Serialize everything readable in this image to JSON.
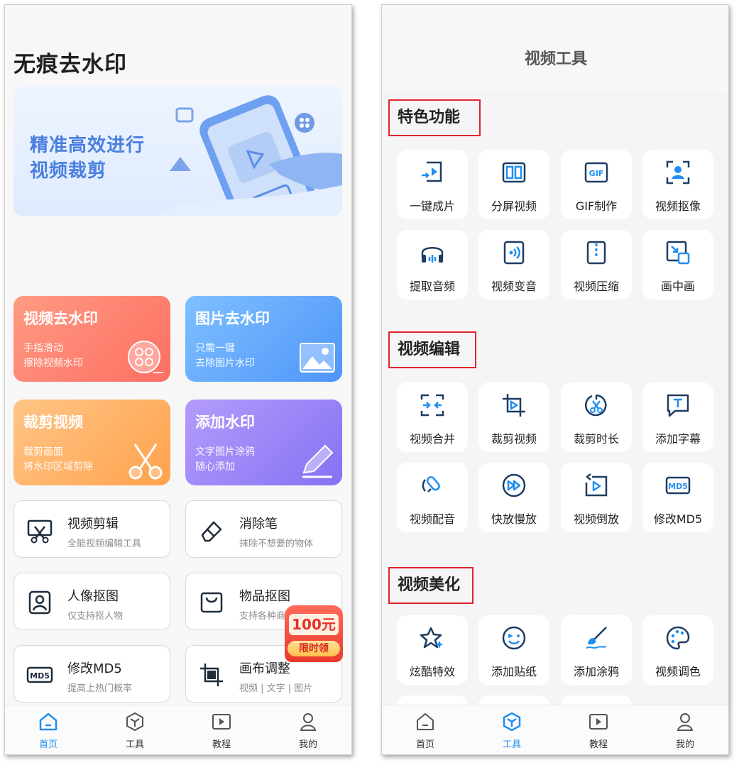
{
  "home": {
    "app_title": "无痕去水印",
    "banner": {
      "line1": "精准高效进行",
      "line2": "视频裁剪"
    },
    "feature_cards": [
      {
        "title": "视频去水印",
        "sub1": "手指滑动",
        "sub2": "擦除视频水印",
        "icon": "film-reel-icon"
      },
      {
        "title": "图片去水印",
        "sub1": "只需一键",
        "sub2": "去除图片水印",
        "icon": "picture-icon"
      },
      {
        "title": "裁剪视频",
        "sub1": "裁剪画面",
        "sub2": "将水印区域剪除",
        "icon": "scissors-icon"
      },
      {
        "title": "添加水印",
        "sub1": "文字图片涂鸦",
        "sub2": "随心添加",
        "icon": "pen-icon"
      }
    ],
    "tools": [
      {
        "title": "视频剪辑",
        "sub": "全能视频编辑工具",
        "icon": "video-cut-icon"
      },
      {
        "title": "消除笔",
        "sub": "抹除不想要的物体",
        "icon": "eraser-icon"
      },
      {
        "title": "人像抠图",
        "sub": "仅支持抠人物",
        "icon": "portrait-icon"
      },
      {
        "title": "物品抠图",
        "sub": "支持各种商",
        "icon": "bag-icon"
      },
      {
        "title": "修改MD5",
        "sub": "提高上热门概率",
        "icon": "md5-icon"
      },
      {
        "title": "画布调整",
        "sub": "视频 | 文字 | 图片",
        "icon": "crop-icon"
      }
    ],
    "promo": {
      "amount": "100元",
      "label": "限时领"
    }
  },
  "tools_page": {
    "title": "视频工具",
    "sections": [
      {
        "title": "特色功能",
        "items": [
          "一键成片",
          "分屏视频",
          "GIF制作",
          "视频抠像",
          "提取音频",
          "视频变音",
          "视频压缩",
          "画中画"
        ]
      },
      {
        "title": "视频编辑",
        "items": [
          "视频合并",
          "裁剪视频",
          "裁剪时长",
          "添加字幕",
          "视频配音",
          "快放慢放",
          "视频倒放",
          "修改MD5"
        ]
      },
      {
        "title": "视频美化",
        "items": [
          "炫酷特效",
          "添加贴纸",
          "添加涂鸦",
          "视频调色"
        ]
      }
    ]
  },
  "tabbar": {
    "home": "首页",
    "tools": "工具",
    "tutorial": "教程",
    "mine": "我的"
  },
  "colors": {
    "accent_blue": "#1f8ef0",
    "icon_navy": "#1d3d63",
    "highlight_red": "#e0242c"
  }
}
